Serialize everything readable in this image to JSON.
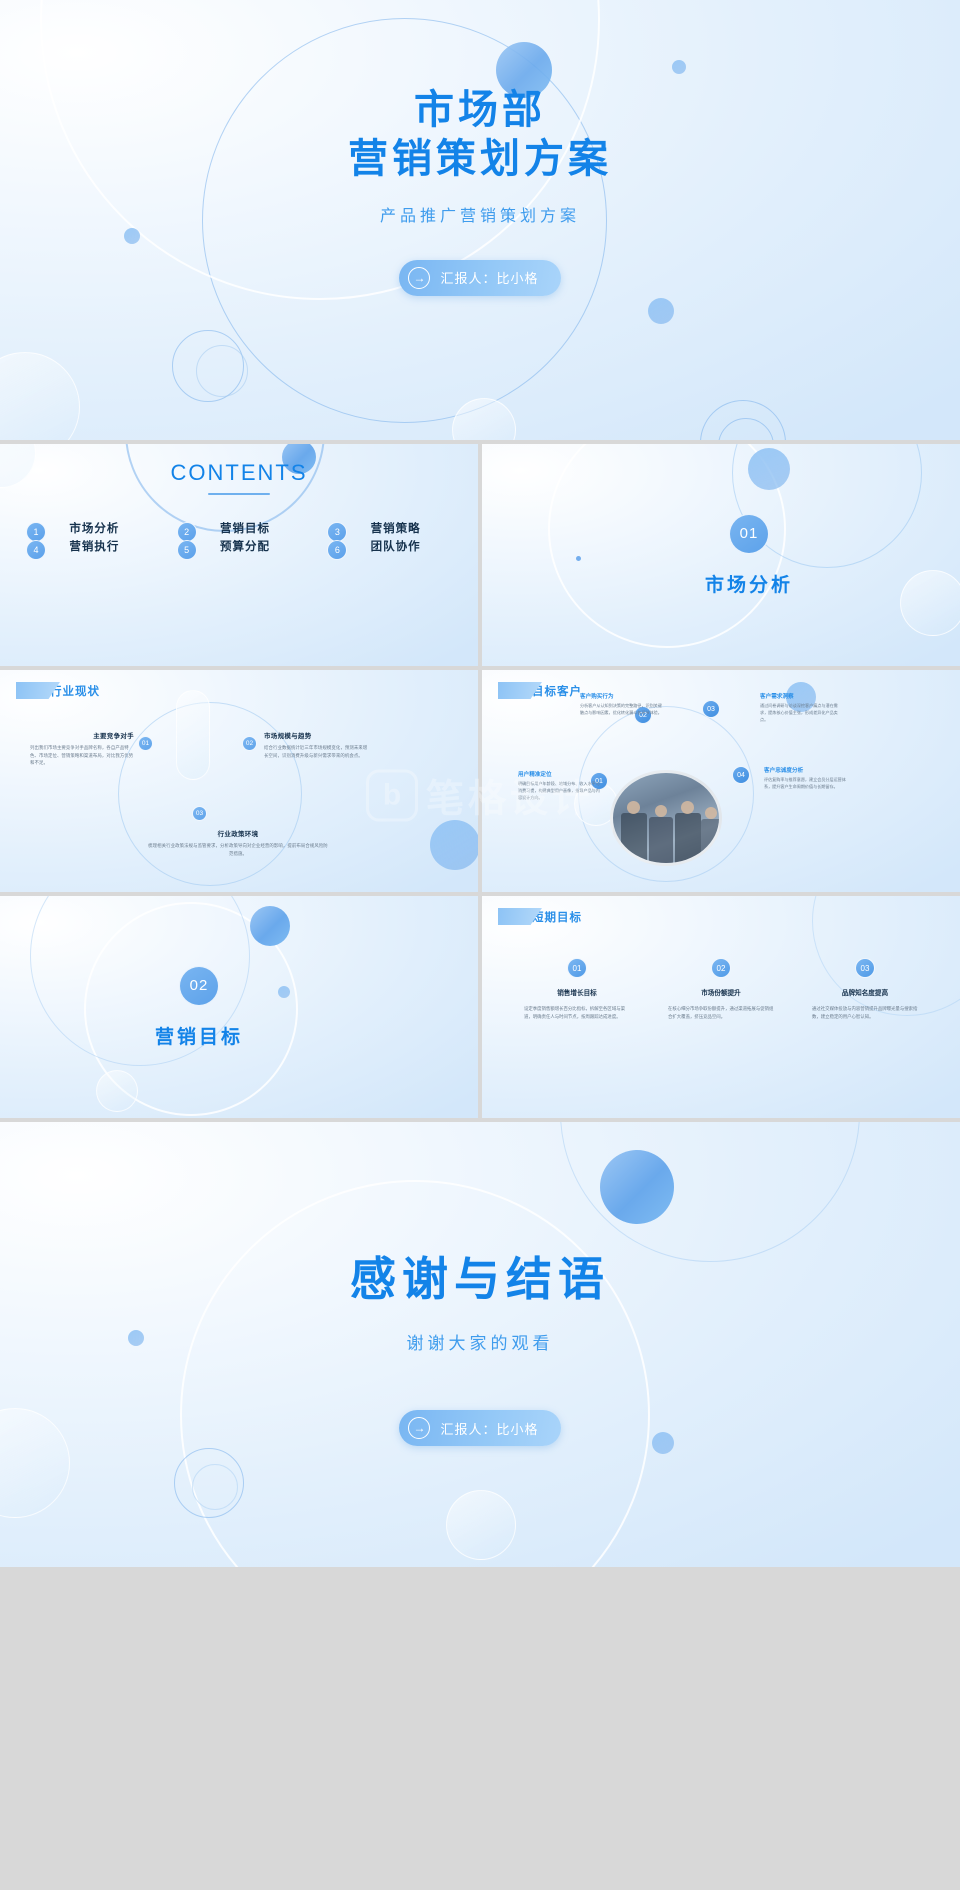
{
  "theme": {
    "accent": "#1383e8",
    "accent_soft": "#6aa9ec",
    "text_dark": "#16324d",
    "text_muted": "#6a7b8c"
  },
  "cover": {
    "title_line1": "市场部",
    "title_line2": "营销策划方案",
    "subtitle": "产品推广营销策划方案",
    "presenter_button": "汇报人：比小格",
    "arrow_icon": "→"
  },
  "contents": {
    "heading": "CONTENTS",
    "items": [
      {
        "num": "1",
        "label": "市场分析"
      },
      {
        "num": "2",
        "label": "营销目标"
      },
      {
        "num": "3",
        "label": "营销策略"
      },
      {
        "num": "4",
        "label": "营销执行"
      },
      {
        "num": "5",
        "label": "预算分配"
      },
      {
        "num": "6",
        "label": "团队协作"
      }
    ]
  },
  "section_01": {
    "num": "01",
    "title": "市场分析"
  },
  "section_02": {
    "num": "02",
    "title": "营销目标"
  },
  "slide_industry": {
    "tag": "行业现状",
    "items": [
      {
        "num": "01",
        "title": "主要竞争对手",
        "body": "列出我们市场主要竞争对手品牌名称，各自产品特色、市场定位、营销策略和渠道布局，对比我方优势和不足。"
      },
      {
        "num": "02",
        "title": "市场规模与趋势",
        "body": "结合行业数据统计近三年市场规模变化，预测未来增长空间，识别消费升级与新兴需求带来的机会点。"
      },
      {
        "num": "03",
        "title": "行业政策环境",
        "body": "梳理相关行业政策法规与监管要求，分析政策导向对企业经营的影响，提前布局合规风险防范措施。"
      }
    ]
  },
  "slide_customer": {
    "tag": "目标客户",
    "items": [
      {
        "num": "01",
        "title": "用户精准定位",
        "body": "明确目标用户年龄段、地域分布、收入水平与消费习惯，构建典型用户画像，指导产品与内容设计方向。"
      },
      {
        "num": "02",
        "title": "客户购买行为",
        "body": "分析客户从认知到决策的完整路径，识别关键触点与影响因素，优化转化漏斗各环节体验。"
      },
      {
        "num": "03",
        "title": "客户需求洞察",
        "body": "通过问卷调研与访谈深挖客户痛点与潜在需求，提炼核心价值主张，形成差异化产品卖点。"
      },
      {
        "num": "04",
        "title": "客户忠诚度分析",
        "body": "评估复购率与推荐意愿，建立会员分层运营体系，提升客户生命周期价值与长期留存。"
      }
    ]
  },
  "slide_shortterm": {
    "tag": "短期目标",
    "items": [
      {
        "num": "01",
        "title": "销售增长目标",
        "body": "设定季度销售额增长百分比指标，拆解至各区域与渠道，明确责任人与时间节点，按周跟踪达成进度。"
      },
      {
        "num": "02",
        "title": "市场份额提升",
        "body": "在核心细分市场争取份额提升，通过渠道拓展与促销组合扩大覆盖，挤压竞品空间。"
      },
      {
        "num": "03",
        "title": "品牌知名度提高",
        "body": "通过社交媒体投放与内容营销提升品牌曝光量与搜索指数，建立稳定的用户心智认知。"
      }
    ]
  },
  "closing": {
    "title": "感谢与结语",
    "subtitle": "谢谢大家的观看",
    "presenter_button": "汇报人：比小格",
    "arrow_icon": "→"
  },
  "watermark": {
    "logo": "b",
    "text": "笔格设计"
  }
}
